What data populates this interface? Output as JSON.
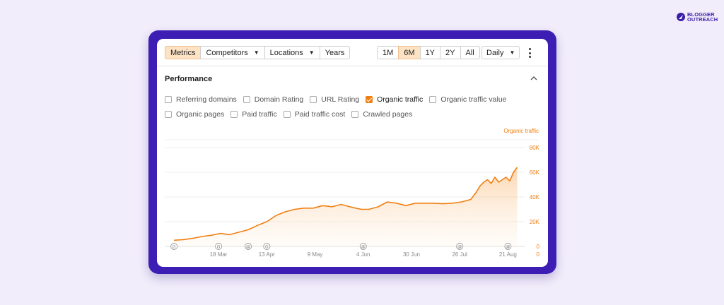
{
  "brand": {
    "line1": "BLOGGER",
    "line2": "OUTREACH"
  },
  "toolbar": {
    "tabs": [
      {
        "label": "Metrics",
        "active": true,
        "dropdown": false
      },
      {
        "label": "Competitors",
        "active": false,
        "dropdown": true
      },
      {
        "label": "Locations",
        "active": false,
        "dropdown": true
      },
      {
        "label": "Years",
        "active": false,
        "dropdown": false
      }
    ],
    "ranges": [
      {
        "label": "1M",
        "active": false
      },
      {
        "label": "6M",
        "active": true
      },
      {
        "label": "1Y",
        "active": false
      },
      {
        "label": "2Y",
        "active": false
      },
      {
        "label": "All",
        "active": false
      }
    ],
    "interval": "Daily",
    "more_icon": "kebab-icon"
  },
  "panel": {
    "title": "Performance",
    "collapse_icon": "chevron-up-icon",
    "metrics_row1": [
      {
        "label": "Referring domains",
        "checked": false
      },
      {
        "label": "Domain Rating",
        "checked": false
      },
      {
        "label": "URL Rating",
        "checked": false
      },
      {
        "label": "Organic traffic",
        "checked": true
      },
      {
        "label": "Organic traffic value",
        "checked": false
      }
    ],
    "metrics_row2": [
      {
        "label": "Organic pages",
        "checked": false
      },
      {
        "label": "Paid traffic",
        "checked": false
      },
      {
        "label": "Paid traffic cost",
        "checked": false
      },
      {
        "label": "Crawled pages",
        "checked": false
      }
    ]
  },
  "colors": {
    "accent": "#f07f12",
    "frame": "#3c1eb4",
    "active_bg": "#fde2c4"
  },
  "chart_data": {
    "type": "area",
    "series_label": "Organic traffic",
    "y_ticks": [
      "80K",
      "60K",
      "40K",
      "20K",
      "0"
    ],
    "ylim": [
      0,
      80000
    ],
    "x_ticks": [
      "18 Mar",
      "13 Apr",
      "9 May",
      "4 Jun",
      "30 Jun",
      "26 Jul",
      "21 Aug"
    ],
    "x_tick_days": [
      29,
      55,
      81,
      107,
      133,
      159,
      185
    ],
    "x_range_days": [
      0,
      194
    ],
    "annotations": [
      {
        "day": 5,
        "symbol": "G"
      },
      {
        "day": 29,
        "symbol": "G"
      },
      {
        "day": 45,
        "symbol": "@"
      },
      {
        "day": 55,
        "symbol": "G"
      },
      {
        "day": 107,
        "symbol": "@"
      },
      {
        "day": 159,
        "symbol": "@"
      },
      {
        "day": 185,
        "symbol": "@"
      }
    ],
    "series": [
      {
        "name": "Organic traffic",
        "x": [
          5,
          10,
          15,
          20,
          25,
          30,
          35,
          40,
          45,
          50,
          55,
          60,
          65,
          70,
          75,
          80,
          85,
          88,
          90,
          95,
          100,
          103,
          106,
          110,
          115,
          120,
          125,
          130,
          135,
          140,
          145,
          150,
          155,
          160,
          165,
          168,
          170,
          172,
          174,
          176,
          178,
          180,
          182,
          184,
          186,
          188,
          190
        ],
        "y": [
          5000,
          5500,
          6500,
          8000,
          9000,
          10500,
          9500,
          11500,
          13500,
          17000,
          20000,
          25000,
          28000,
          30000,
          31000,
          31000,
          33000,
          32500,
          32000,
          34000,
          32000,
          31000,
          30000,
          30000,
          32000,
          36000,
          35000,
          33000,
          35000,
          35000,
          35000,
          34500,
          35000,
          36000,
          38000,
          44000,
          49000,
          52000,
          54000,
          51000,
          56000,
          52000,
          54000,
          56000,
          53000,
          60000,
          64000
        ]
      }
    ],
    "grid": true,
    "legend": "top-right"
  }
}
